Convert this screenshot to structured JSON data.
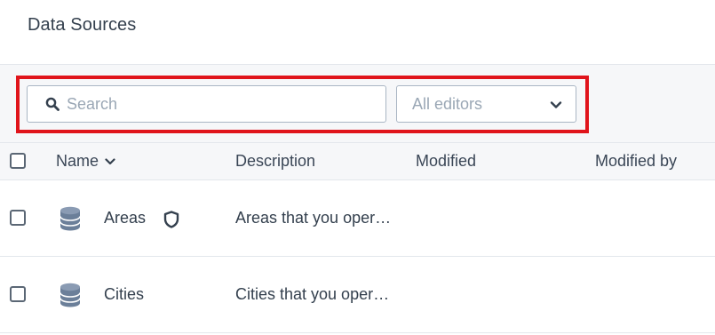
{
  "header": {
    "title": "Data Sources"
  },
  "filters": {
    "search_placeholder": "Search",
    "search_value": "",
    "editors_selected": "All editors"
  },
  "colors": {
    "highlight": "#e0141b",
    "icon": "#6b7f99",
    "text": "#34404e",
    "muted": "#9aa7b5"
  },
  "table": {
    "columns": [
      "Name",
      "Description",
      "Modified",
      "Modified by"
    ],
    "sort_column": "Name",
    "sort_direction": "descending",
    "rows": [
      {
        "name": "Areas",
        "description": "Areas that you oper…",
        "modified": "",
        "modified_by": "",
        "icon": "database-icon",
        "badge_icon": "shield-icon"
      },
      {
        "name": "Cities",
        "description": "Cities that you oper…",
        "modified": "",
        "modified_by": "",
        "icon": "database-icon"
      }
    ]
  }
}
